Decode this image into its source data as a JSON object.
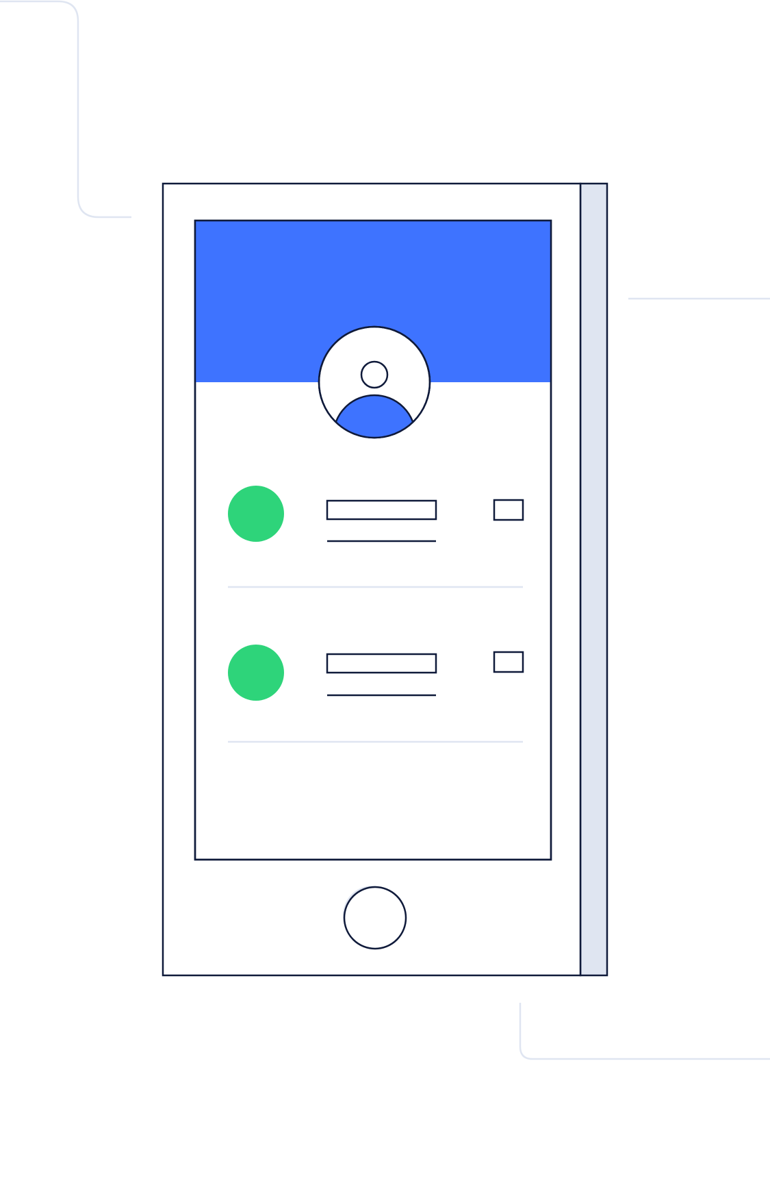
{
  "colors": {
    "background": "#ffffff",
    "outline": "#0f1a3a",
    "header_blue": "#3e73ff",
    "status_green": "#2ed47a",
    "side_panel": "#dfe5f1",
    "decor_line": "#dfe5f1",
    "divider": "#dfe5f1",
    "screen": "#ffffff"
  },
  "icons": {
    "avatar": "user-avatar-icon",
    "home_button": "home-button-icon",
    "status_dot": "status-dot-icon"
  },
  "list_items": [
    {
      "status": "online"
    },
    {
      "status": "online"
    }
  ]
}
